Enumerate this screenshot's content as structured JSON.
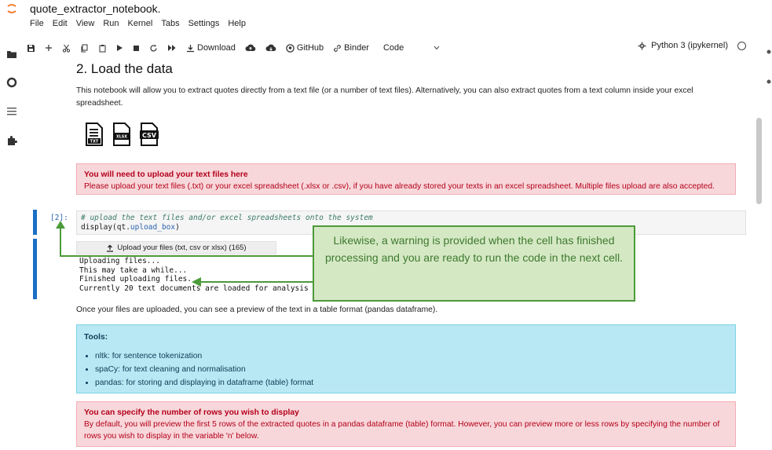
{
  "window": {
    "title": "quote_extractor_notebook."
  },
  "menu": [
    "File",
    "Edit",
    "View",
    "Run",
    "Kernel",
    "Tabs",
    "Settings",
    "Help"
  ],
  "toolbar": {
    "download": "Download",
    "github": "GitHub",
    "binder": "Binder",
    "cell_type": "Code",
    "kernel": "Python 3 (ipykernel)"
  },
  "notebook": {
    "heading": "2. Load the data",
    "intro": "This notebook will allow you to extract quotes directly from a text file (or a number of text files). Alternatively, you can also extract quotes from a text column inside your excel spreadsheet.",
    "file_icons": [
      "TXT",
      "XLSX",
      "CSV"
    ],
    "upload_alert": {
      "title": "You will need to upload your text files here",
      "body": "Please upload your text files (.txt) or your excel spreadsheet (.xlsx or .csv), if you have already stored your texts in an excel spreadsheet. Multiple files upload are also accepted."
    },
    "code_cell": {
      "prompt": "[2]:",
      "comment": "# upload the text files and/or excel spreadsheets onto the system",
      "code_prefix": "display(qt.",
      "code_attr": "upload_box",
      "code_suffix": ")"
    },
    "upload_button": "Upload your files (txt, csv or xlsx) (165)",
    "output_lines": [
      "Uploading files...",
      "This may take a while...",
      "Finished uploading files.",
      "Currently 20 text documents are loaded for analysis"
    ],
    "preview_text": "Once your files are uploaded, you can see a preview of the text in a table format (pandas dataframe).",
    "tools": {
      "title": "Tools:",
      "items": [
        "nltk: for sentence tokenization",
        "spaCy: for text cleaning and normalisation",
        "pandas: for storing and displaying in dataframe (table) format"
      ]
    },
    "rows_alert": {
      "title": "You can specify the number of rows you wish to display",
      "body": "By default, you will preview the first 5 rows of the extracted quotes in a pandas dataframe (table) format. However, you can preview more or less rows by specifying the number of rows you wish to display in the variable 'n' below."
    }
  },
  "annotation": {
    "text": "Likewise, a warning is provided when the cell has finished processing and you are ready to run the code in the next cell.",
    "color": "#4c9a3a"
  },
  "colors": {
    "accent": "#1a6fc4",
    "alert_red_bg": "#f8d7da",
    "alert_red_text": "#b3001b",
    "alert_blue_bg": "#b8e8f3"
  }
}
